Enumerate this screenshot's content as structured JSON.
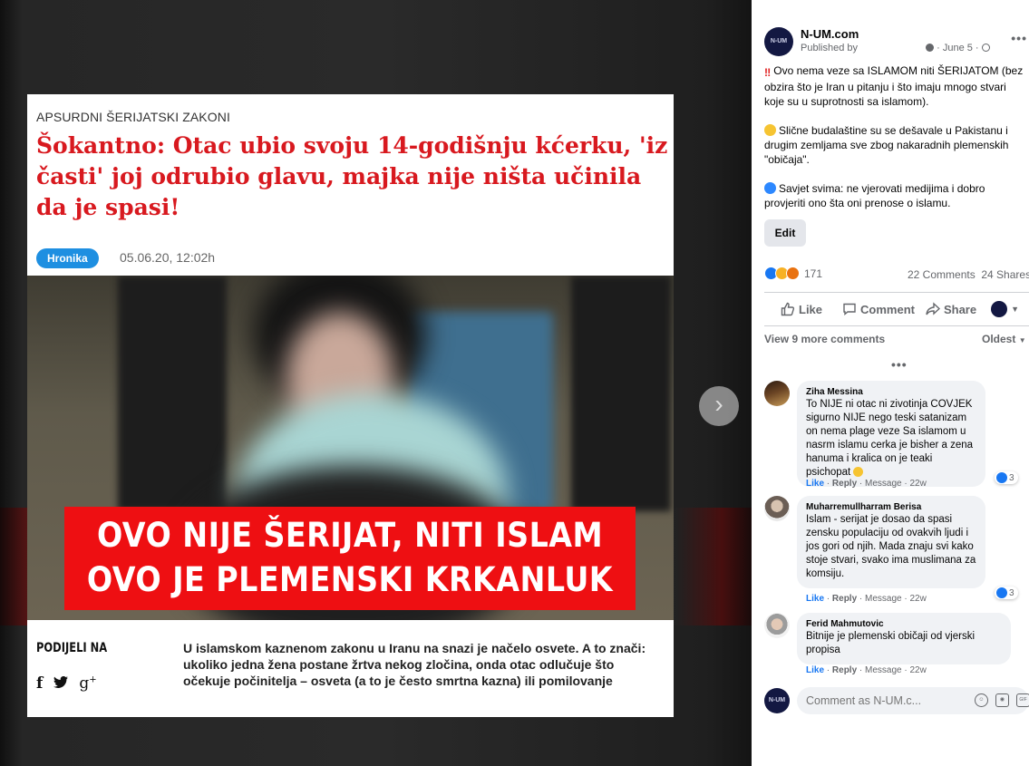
{
  "article": {
    "category": "APSURDNI ŠERIJATSKI ZAKONI",
    "title": "Šokantno: Otac ubio svoju 14-godišnju kćerku, 'iz časti' joj odrubio glavu, majka nije ništa učinila da je spasi!",
    "tag": "Hronika",
    "date": "05.06.20, 12:02h",
    "banner_line1": "OVO NIJE ŠERIJAT, NITI ISLAM",
    "banner_line2": "OVO JE PLEMENSKI KRKANLUK",
    "share_label": "PODIJELI NA",
    "share_icons": [
      "facebook-icon",
      "twitter-icon",
      "google-plus-icon"
    ],
    "lead": "U islamskom kaznenom zakonu u Iranu na snazi je načelo osvete. A to znači: ukoliko jedna žena postane žrtva nekog zločina, onda otac odlučuje što očekuje počinitelja – osveta (a to je često smrtna kazna) ili pomilovanje"
  },
  "post": {
    "page_name": "N-UM.com",
    "avatar_text": "N-UM",
    "published_by": "Published by",
    "date": "June 5",
    "paragraph1": "Ovo nema veze sa ISLAMOM niti ŠERIJATOM (bez obzira što je Iran u pitanju i što imaju mnogo stvari koje su u suprotnosti sa islamom).",
    "paragraph2": "Slične budalaštine su se dešavale u Pakistanu i drugim zemljama sve zbog nakaradnih plemenskih \"običaja\".",
    "paragraph3": "Savjet svima: ne vjerovati medijima i dobro provjeriti ono šta oni prenose o islamu.",
    "edit_label": "Edit",
    "reaction_count": "171",
    "comments_count": "22 Comments",
    "shares_count": "24 Shares",
    "actions": {
      "like": "Like",
      "comment": "Comment",
      "share": "Share"
    },
    "view_more": "View 9 more comments",
    "sort": "Oldest"
  },
  "comments": [
    {
      "author": "Ziha Messina",
      "text": "To NIJE ni otac ni zivotinja COVJEK sigurno NIJE nego teski satanizam on nema plage veze Sa islamom u nasrm islamu cerka je bisher a zena hanuma i kralica on je teaki psichopat",
      "like": "Like",
      "reply": "Reply",
      "message": "Message",
      "time": "22w",
      "reactions": "3"
    },
    {
      "author": "Muharremullharram Berisa",
      "text": "Islam - serijat je dosao da spasi zensku populaciju od ovakvih ljudi i jos gori od njih. Mada znaju svi kako stoje stvari, svako ima muslimana za komsiju.",
      "like": "Like",
      "reply": "Reply",
      "message": "Message",
      "time": "22w",
      "reactions": "3"
    },
    {
      "author": "Ferid Mahmutovic",
      "text": "Bitnije je plemenski običaji od vjerski propisa",
      "like": "Like",
      "reply": "Reply",
      "message": "Message",
      "time": "22w",
      "reactions": ""
    }
  ],
  "composer": {
    "placeholder": "Comment as N-UM.c...",
    "avatar_text": "N-UM"
  },
  "colors": {
    "headline_red": "#d8191f",
    "banner_red": "#ee0f12",
    "tag_blue": "#1e8fe1",
    "fb_blue": "#1877f2"
  }
}
